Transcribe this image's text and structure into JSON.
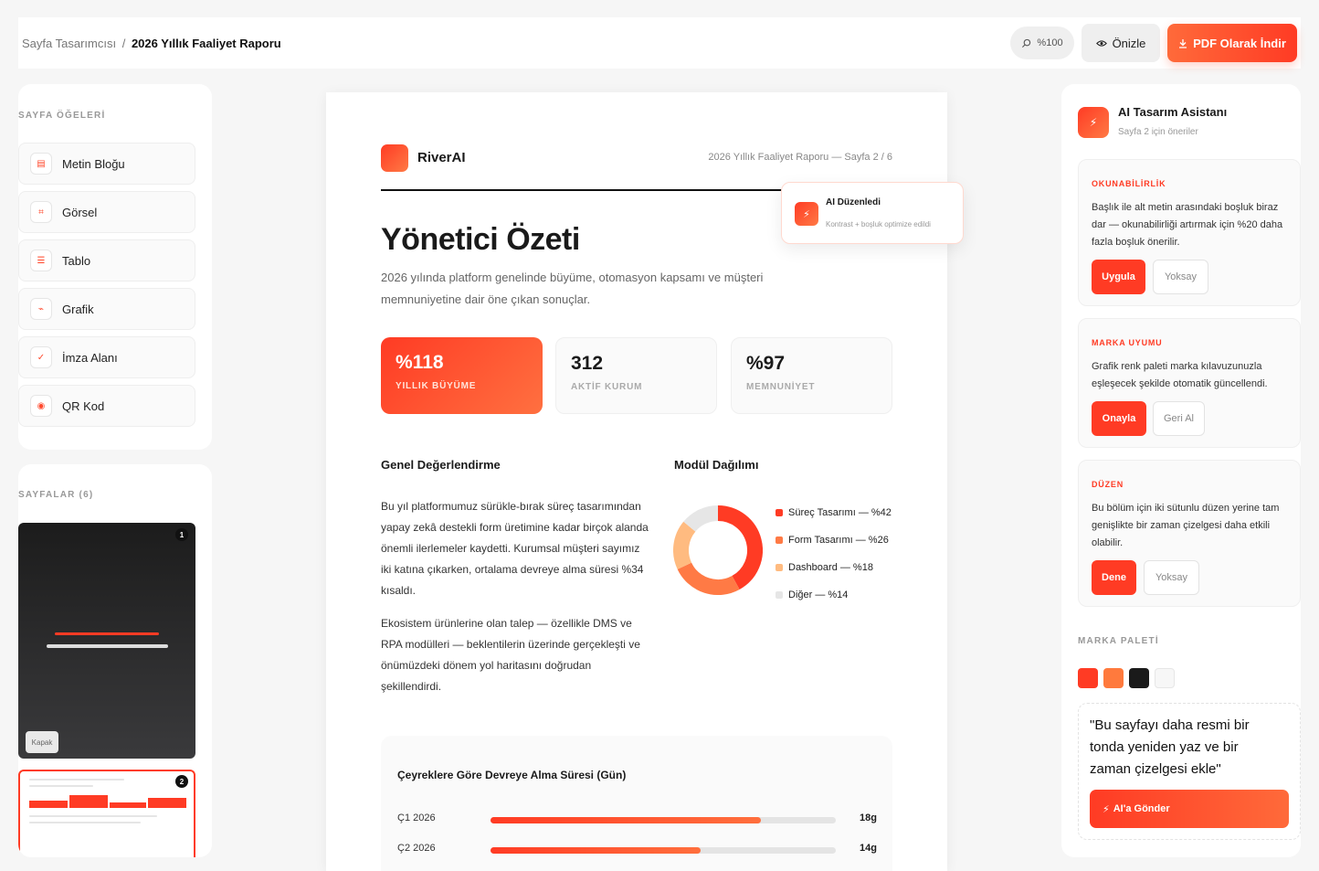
{
  "header": {
    "breadcrumb_parent": "Sayfa Tasarımcısı",
    "breadcrumb_sep": "/",
    "breadcrumb_current": "2026 Yıllık Faaliyet Raporu",
    "zoom": "%100",
    "preview_label": "Önizle",
    "download_label": "PDF Olarak İndir"
  },
  "elements_panel": {
    "title": "SAYFA ÖĞELERİ",
    "items": [
      {
        "label": "Metin Bloğu",
        "icon": "text-block-icon"
      },
      {
        "label": "Görsel",
        "icon": "image-icon"
      },
      {
        "label": "Tablo",
        "icon": "table-icon"
      },
      {
        "label": "Grafik",
        "icon": "chart-icon"
      },
      {
        "label": "İmza Alanı",
        "icon": "signature-icon"
      },
      {
        "label": "QR Kod",
        "icon": "qr-code-icon"
      }
    ]
  },
  "pages_panel": {
    "title": "SAYFALAR (6)",
    "pages": [
      {
        "number": "1",
        "tag": "Kapak"
      },
      {
        "number": "2"
      }
    ]
  },
  "document": {
    "brand": "RiverAI",
    "meta": "2026 Yıllık Faaliyet Raporu — Sayfa 2 / 6",
    "title": "Yönetici Özeti",
    "subtitle": "2026 yılında platform genelinde büyüme, otomasyon kapsamı ve müşteri memnuniyetine dair öne çıkan sonuçlar.",
    "kpis": [
      {
        "value": "%118",
        "label": "YILLIK BÜYÜME"
      },
      {
        "value": "312",
        "label": "AKTİF KURUM"
      },
      {
        "value": "%97",
        "label": "MEMNUNİYET"
      }
    ],
    "overview_title": "Genel Değerlendirme",
    "paragraph1": "Bu yıl platformumuz sürükle-bırak süreç tasarımından yapay zekâ destekli form üretimine kadar birçok alanda önemli ilerlemeler kaydetti. Kurumsal müşteri sayımız iki katına çıkarken, ortalama devreye alma süresi %34 kısaldı.",
    "paragraph2": "Ekosistem ürünlerine olan talep — özellikle DMS ve RPA modülleri — beklentilerin üzerinde gerçekleşti ve önümüzdeki dönem yol haritasını doğrudan şekillendirdi.",
    "module_title": "Modül Dağılımı",
    "bar_chart_title": "Çeyreklere Göre Devreye Alma Süresi (Gün)"
  },
  "chart_data": [
    {
      "type": "pie",
      "title": "Modül Dağılımı",
      "categories": [
        "Süreç Tasarımı",
        "Form Tasarımı",
        "Dashboard",
        "Diğer"
      ],
      "values": [
        42,
        26,
        18,
        14
      ],
      "labels": [
        "Süreç Tasarımı — %42",
        "Form Tasarımı — %26",
        "Dashboard — %18",
        "Diğer — %14"
      ],
      "colors": [
        "#ff3b24",
        "#ff7a45",
        "#ffbb80",
        "#e6e6e6"
      ]
    },
    {
      "type": "bar",
      "title": "Çeyreklere Göre Devreye Alma Süresi (Gün)",
      "categories": [
        "Ç1 2026",
        "Ç2 2026"
      ],
      "values": [
        18,
        14
      ],
      "value_labels": [
        "18g",
        "14g"
      ],
      "xlim": [
        0,
        23
      ]
    }
  ],
  "ai_badge": {
    "title": "AI Düzenledi",
    "subtitle": "Kontrast + boşluk optimize edildi"
  },
  "assistant": {
    "title": "AI Tasarım Asistanı",
    "subtitle": "Sayfa 2 için öneriler",
    "suggestions": [
      {
        "kicker": "OKUNABİLİRLİK",
        "text": "Başlık ile alt metin arasındaki boşluk biraz dar — okunabilirliği artırmak için %20 daha fazla boşluk önerilir.",
        "primary": "Uygula",
        "secondary": "Yoksay"
      },
      {
        "kicker": "MARKA UYUMU",
        "text": "Grafik renk paleti marka kılavuzunuzla eşleşecek şekilde otomatik güncellendi.",
        "primary": "Onayla",
        "secondary": "Geri Al"
      },
      {
        "kicker": "DÜZEN",
        "text": "Bu bölüm için iki sütunlu düzen yerine tam genişlikte bir zaman çizelgesi daha etkili olabilir.",
        "primary": "Dene",
        "secondary": "Yoksay"
      }
    ],
    "palette_title": "MARKA PALETİ",
    "palette": [
      "#ff3b24",
      "#ff7a3d",
      "#1a1a1a",
      "#f7f7f7"
    ],
    "prompt_text": "\"Bu sayfayı daha resmi bir tonda yeniden yaz ve bir zaman çizelgesi ekle\"",
    "send_label": "AI'a Gönder"
  }
}
